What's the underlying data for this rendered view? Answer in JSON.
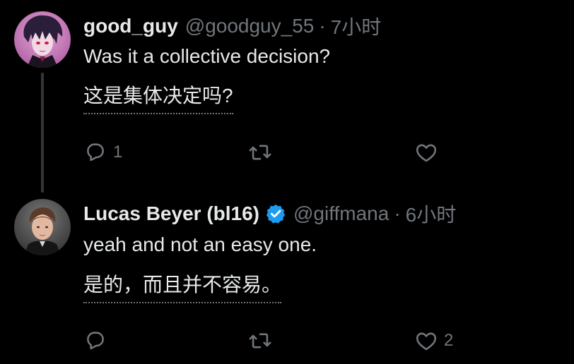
{
  "colors": {
    "background": "#000000",
    "text_primary": "#e7e9ea",
    "text_secondary": "#71767b",
    "verified_blue": "#1d9bf0",
    "thread_line": "#333639"
  },
  "tweets": [
    {
      "display_name": "good_guy",
      "handle": "@goodguy_55",
      "separator": "·",
      "time": "7小时",
      "text": "Was it a collective decision?",
      "translation": "这是集体决定吗?",
      "verified": false,
      "actions": {
        "reply_icon": "reply-icon",
        "reply_count": "1",
        "retweet_icon": "retweet-icon",
        "retweet_count": "",
        "like_icon": "heart-icon",
        "like_count": ""
      }
    },
    {
      "display_name": "Lucas Beyer (bl16)",
      "handle": "@giffmana",
      "separator": "·",
      "time": "6小时",
      "text": "yeah and not an easy one.",
      "translation": "是的，而且并不容易。",
      "verified": true,
      "actions": {
        "reply_icon": "reply-icon",
        "reply_count": "",
        "retweet_icon": "retweet-icon",
        "retweet_count": "",
        "like_icon": "heart-icon",
        "like_count": "2"
      }
    }
  ]
}
